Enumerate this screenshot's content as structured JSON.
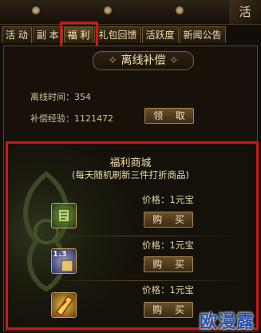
{
  "header": {
    "corner_label": "活"
  },
  "tabs": [
    {
      "label": "活 动"
    },
    {
      "label": "副 本"
    },
    {
      "label": "福 利",
      "active": true
    },
    {
      "label": "礼包回馈"
    },
    {
      "label": "活跃度"
    },
    {
      "label": "新闻公告"
    }
  ],
  "offline": {
    "title": "离线补偿",
    "time_label": "离线时间：354",
    "exp_label": "补偿经验：1121472",
    "claim_button": "领 取"
  },
  "shop": {
    "title": "福利商城",
    "subtitle": "(每天随机刷新三件打折商品)",
    "items": [
      {
        "icon": "green-scroll-icon",
        "price": "价格：1元宝",
        "buy_label": "购 买"
      },
      {
        "icon": "multiplier-scroll-icon",
        "badge": "1.3",
        "price": "价格：1元宝",
        "buy_label": "购 买"
      },
      {
        "icon": "golden-talisman-icon",
        "price": "价格：1元宝",
        "buy_label": "购 买"
      }
    ]
  },
  "watermark": "欧漫露",
  "colors": {
    "highlight": "#d21515",
    "gold_text": "#f0dfae",
    "panel_border": "#5d4828"
  }
}
